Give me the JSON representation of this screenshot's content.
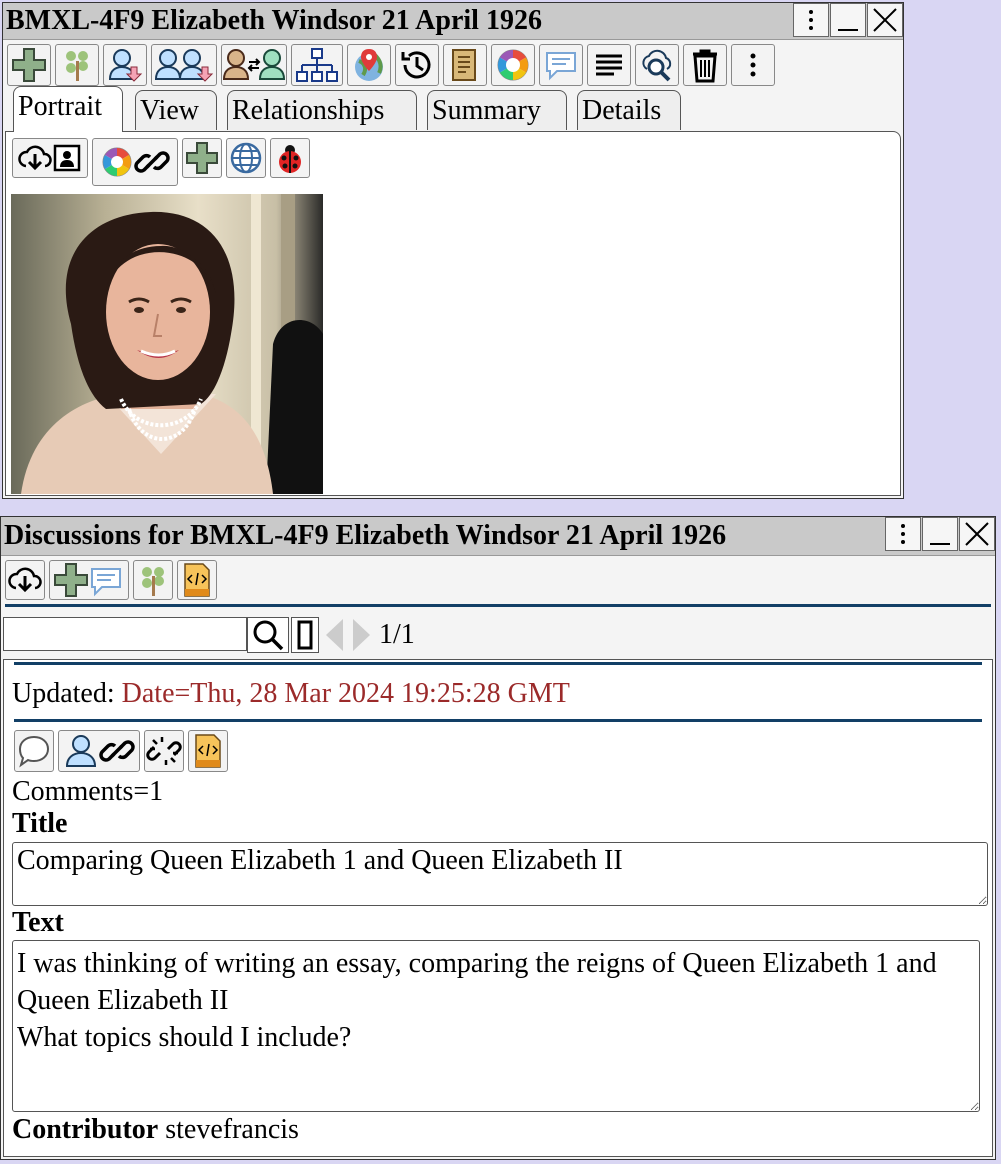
{
  "window1": {
    "title": "BMXL-4F9 Elizabeth Windsor 21 April 1926",
    "tabs": [
      {
        "label": "Portrait",
        "active": true
      },
      {
        "label": "View",
        "active": false
      },
      {
        "label": "Relationships",
        "active": false
      },
      {
        "label": "Summary",
        "active": false
      },
      {
        "label": "Details",
        "active": false
      }
    ],
    "toolbar_icons": [
      "add-person-icon",
      "tree-icon",
      "download-person-icon",
      "download-people-icon",
      "swap-people-icon",
      "pedigree-icon",
      "map-pin-icon",
      "history-icon",
      "scroll-icon",
      "color-wheel-icon",
      "chat-icon",
      "lines-icon",
      "cloud-search-icon",
      "trash-icon",
      "more-icon"
    ],
    "portrait_toolbar_icons": [
      "cloud-download-icon",
      "portrait-icon",
      "color-wheel-icon",
      "link-icon",
      "add-icon",
      "globe-icon",
      "ladybug-icon"
    ]
  },
  "window2": {
    "title": "Discussions for BMXL-4F9 Elizabeth Windsor 21 April 1926",
    "search": {
      "value": "",
      "placeholder": ""
    },
    "pager": "1/1",
    "updated_label": "Updated:",
    "updated_value": "Date=Thu, 28 Mar 2024 19:25:28 GMT",
    "comments": "Comments=1",
    "title_label": "Title",
    "title_value": "Comparing Queen Elizabeth 1 and Queen Elizabeth II",
    "text_label": "Text",
    "text_value": "I was thinking of writing an essay, comparing the reigns of Queen Elizabeth 1 and Queen Elizabeth II\nWhat topics should I include?",
    "contributor_label": "Contributor",
    "contributor_value": "stevefrancis"
  },
  "colors": {
    "accent_line": "#123f66",
    "updated_value": "#9b2a2a",
    "background": "#d9d6f3"
  }
}
